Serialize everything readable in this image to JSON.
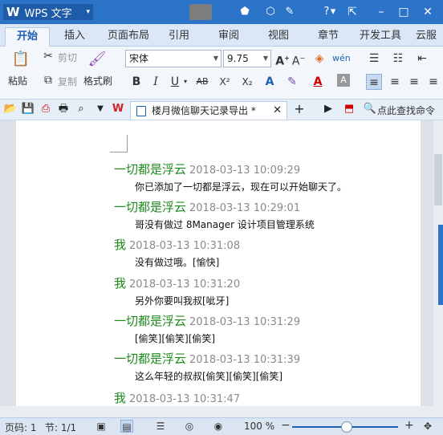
{
  "app": {
    "title": "WPS 文字",
    "dropdown": "▾"
  },
  "titlebar": {
    "icons": [
      "⬟",
      "⬡",
      "✎",
      "?",
      "▾"
    ],
    "window": [
      "⇱",
      "–",
      "□",
      "✕"
    ]
  },
  "tabs": [
    "开始",
    "插入",
    "页面布局",
    "引用",
    "审阅",
    "视图",
    "章节",
    "开发工具",
    "云服"
  ],
  "ribbon": {
    "paste": "粘贴",
    "cut": "剪切",
    "copy": "复制",
    "format_painter": "格式刷",
    "font_name": "宋体",
    "font_size": "9.75",
    "bold": "B",
    "italic": "I",
    "underline": "U",
    "strike": "AB",
    "sup": "X²",
    "sub": "X₂"
  },
  "quick": {
    "doc_title": "楼月微信聊天记录导出 *",
    "close": "✕",
    "add": "+",
    "search": "点此查找命令",
    "wps_mark": "W"
  },
  "messages": [
    {
      "sender": "一切都是浮云",
      "time": "2018-03-13 10:09:29",
      "text": "你已添加了一切都是浮云，现在可以开始聊天了。"
    },
    {
      "sender": "一切都是浮云",
      "time": "2018-03-13 10:29:01",
      "text": "哥没有做过 8Manager 设计项目管理系统"
    },
    {
      "sender": "我",
      "time": "2018-03-13 10:31:08",
      "text": "没有做过哦。[愉快]"
    },
    {
      "sender": "我",
      "time": "2018-03-13 10:31:20",
      "text": "另外你要叫我叔[呲牙]"
    },
    {
      "sender": "一切都是浮云",
      "time": "2018-03-13 10:31:29",
      "text": "[偷笑][偷笑][偷笑]"
    },
    {
      "sender": "一切都是浮云",
      "time": "2018-03-13 10:31:39",
      "text": "这么年轻的叔叔[偷笑][偷笑][偷笑]"
    },
    {
      "sender": "我",
      "time": "2018-03-13 10:31:47",
      "text": ""
    }
  ],
  "status": {
    "page": "页码: 1",
    "section": "节: 1/1",
    "zoom": "100 %",
    "minus": "−",
    "plus": "+",
    "fit": "✥"
  }
}
